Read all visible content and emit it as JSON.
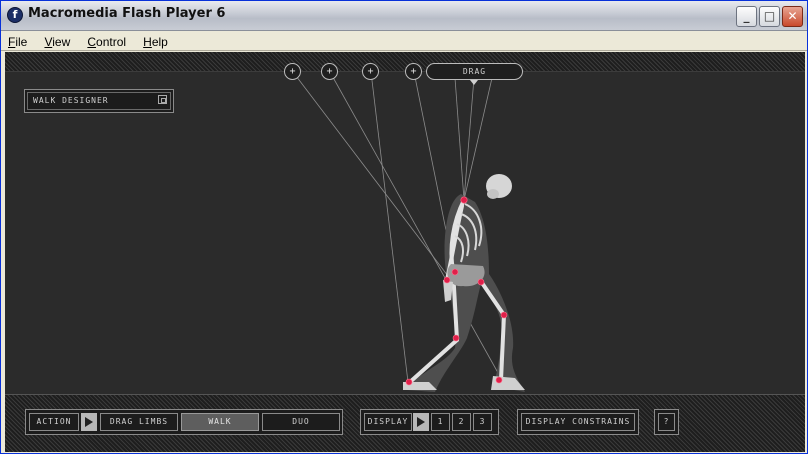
{
  "window": {
    "title": "Macromedia Flash Player 6",
    "app_icon": "flash-icon",
    "controls": [
      "minimize-icon",
      "maximize-icon",
      "close-icon"
    ]
  },
  "menu": {
    "items": [
      {
        "label": "File",
        "underline": "F",
        "rest": "ile"
      },
      {
        "label": "View",
        "underline": "V",
        "rest": "iew"
      },
      {
        "label": "Control",
        "underline": "C",
        "rest": "ontrol"
      },
      {
        "label": "Help",
        "underline": "H",
        "rest": "elp"
      }
    ]
  },
  "stage": {
    "walk_designer_label": "WALK DESIGNER",
    "plus_label": "+",
    "drag_label": "DRAG"
  },
  "controls": {
    "action_label": "ACTION",
    "drag_limbs_label": "DRAG LIMBS",
    "walk_label": "WALK",
    "duo_label": "DUO",
    "selected_action": "WALK",
    "display_label": "DISPLAY",
    "display_options": [
      "1",
      "2",
      "3"
    ],
    "display_constrains_label": "DISPLAY CONSTRAINS",
    "help_label": "?"
  },
  "colors": {
    "stage_bg": "#2b2b2b",
    "joint": "#e0204a",
    "bone": "#e6e6e6"
  }
}
